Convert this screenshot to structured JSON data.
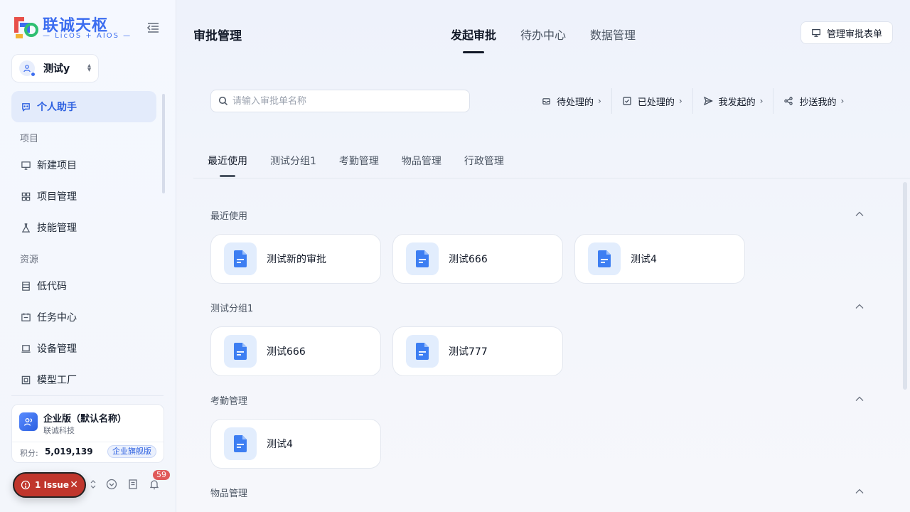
{
  "brand": {
    "title": "联诚天枢",
    "subtitle": "— LicOS + AIOS —"
  },
  "user": {
    "name": "测试y"
  },
  "sidebar": {
    "active": {
      "label": "个人助手"
    },
    "section_project": "项目",
    "project_items": [
      {
        "label": "新建项目"
      },
      {
        "label": "项目管理"
      },
      {
        "label": "技能管理"
      }
    ],
    "section_resource": "资源",
    "resource_items": [
      {
        "label": "低代码"
      },
      {
        "label": "任务中心"
      },
      {
        "label": "设备管理"
      },
      {
        "label": "模型工厂"
      }
    ]
  },
  "org": {
    "name": "企业版（默认名称）",
    "company": "联诚科技",
    "points_label": "积分:",
    "points_value": "5,019,139",
    "edition": "企业旗舰版"
  },
  "footer": {
    "issue_label": "1 Issue",
    "notification_count": "59"
  },
  "header": {
    "title": "审批管理",
    "tabs": [
      {
        "label": "发起审批"
      },
      {
        "label": "待办中心"
      },
      {
        "label": "数据管理"
      }
    ],
    "manage_button": "管理审批表单"
  },
  "search": {
    "placeholder": "请输入审批单名称",
    "value": ""
  },
  "filters": [
    {
      "label": "待处理的",
      "chevron": "›"
    },
    {
      "label": "已处理的",
      "chevron": "›"
    },
    {
      "label": "我发起的",
      "chevron": "›"
    },
    {
      "label": "抄送我的",
      "chevron": "›"
    }
  ],
  "categories": [
    {
      "label": "最近使用"
    },
    {
      "label": "测试分组1"
    },
    {
      "label": "考勤管理"
    },
    {
      "label": "物品管理"
    },
    {
      "label": "行政管理"
    }
  ],
  "groups": [
    {
      "title": "最近使用",
      "forms": [
        "测试新的审批",
        "测试666",
        "测试4"
      ]
    },
    {
      "title": "测试分组1",
      "forms": [
        "测试666",
        "测试777"
      ]
    },
    {
      "title": "考勤管理",
      "forms": [
        "测试4"
      ]
    },
    {
      "title": "物品管理",
      "forms": []
    }
  ],
  "colors": {
    "accent": "#3c6df0",
    "issue": "#c0362c",
    "card_icon_bg": "#e2edfd",
    "doc_icon": "#3d7ef2"
  }
}
